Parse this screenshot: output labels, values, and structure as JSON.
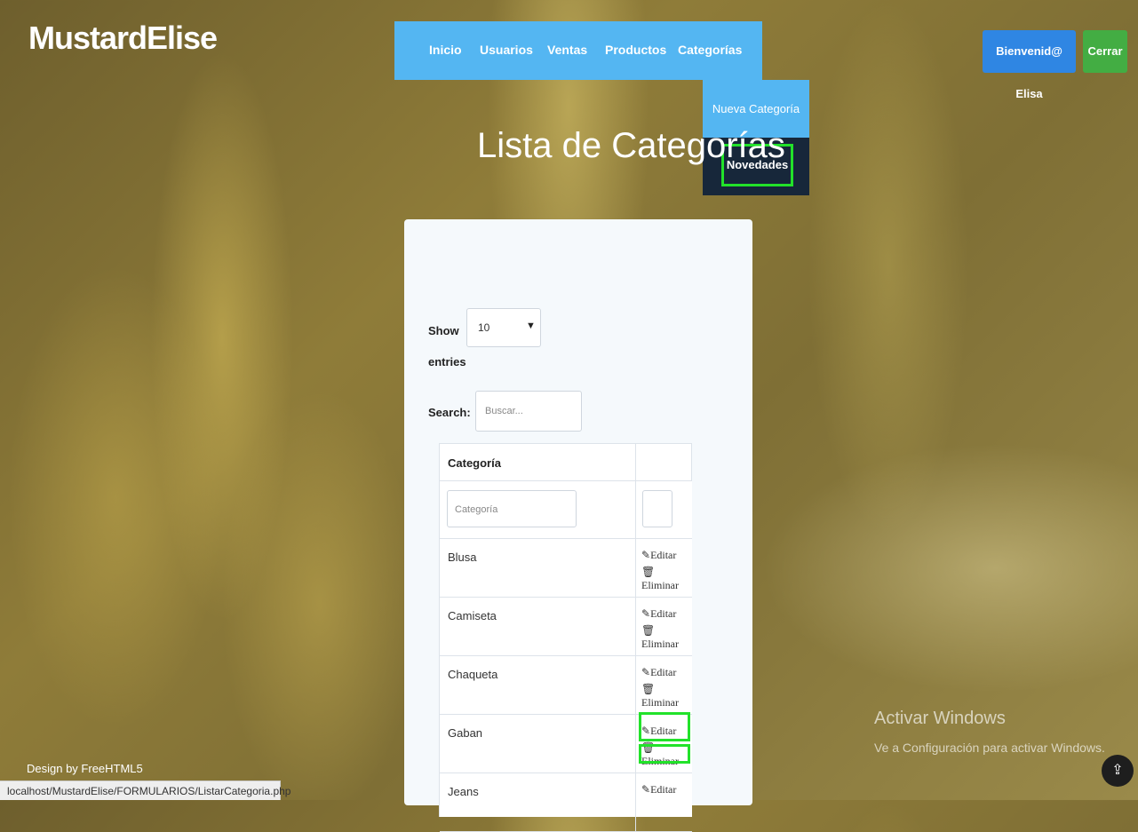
{
  "brand": "MustardElise",
  "nav": {
    "items": [
      "Inicio",
      "Usuarios",
      "Ventas",
      "Productos",
      "Categorías"
    ]
  },
  "dropdown": {
    "items": [
      "Nueva Categoría",
      "Novedades"
    ]
  },
  "header": {
    "welcome": "Bienvenid@ Elisa",
    "logout": "Cerrar"
  },
  "page_title": "Lista de Categorías",
  "controls": {
    "show_label": "Show",
    "entries_label": "entries",
    "entries_value": "10",
    "search_label": "Search:",
    "search_placeholder": "Buscar..."
  },
  "table": {
    "header": "Categoría",
    "filter_placeholder": "Categoría",
    "rows": [
      "Blusa",
      "Camiseta",
      "Chaqueta",
      "Gaban",
      "Jeans"
    ],
    "edit_label": "Editar",
    "delete_label": "Eliminar"
  },
  "watermark": {
    "line1": "Activar Windows",
    "line2": "Ve a Configuración para activar Windows."
  },
  "footer": {
    "design": "Design by FreeHTML5"
  },
  "status_url": "localhost/MustardElise/FORMULARIOS/ListarCategoria.php",
  "icons": {
    "edit": "edit-icon",
    "delete": "trash-icon",
    "share": "share-icon"
  },
  "colors": {
    "nav": "#54b6f2",
    "dropdown_bg": "#17273a",
    "welcome": "#2f86e3",
    "logout": "#43ad43",
    "highlight": "#22e22a"
  }
}
